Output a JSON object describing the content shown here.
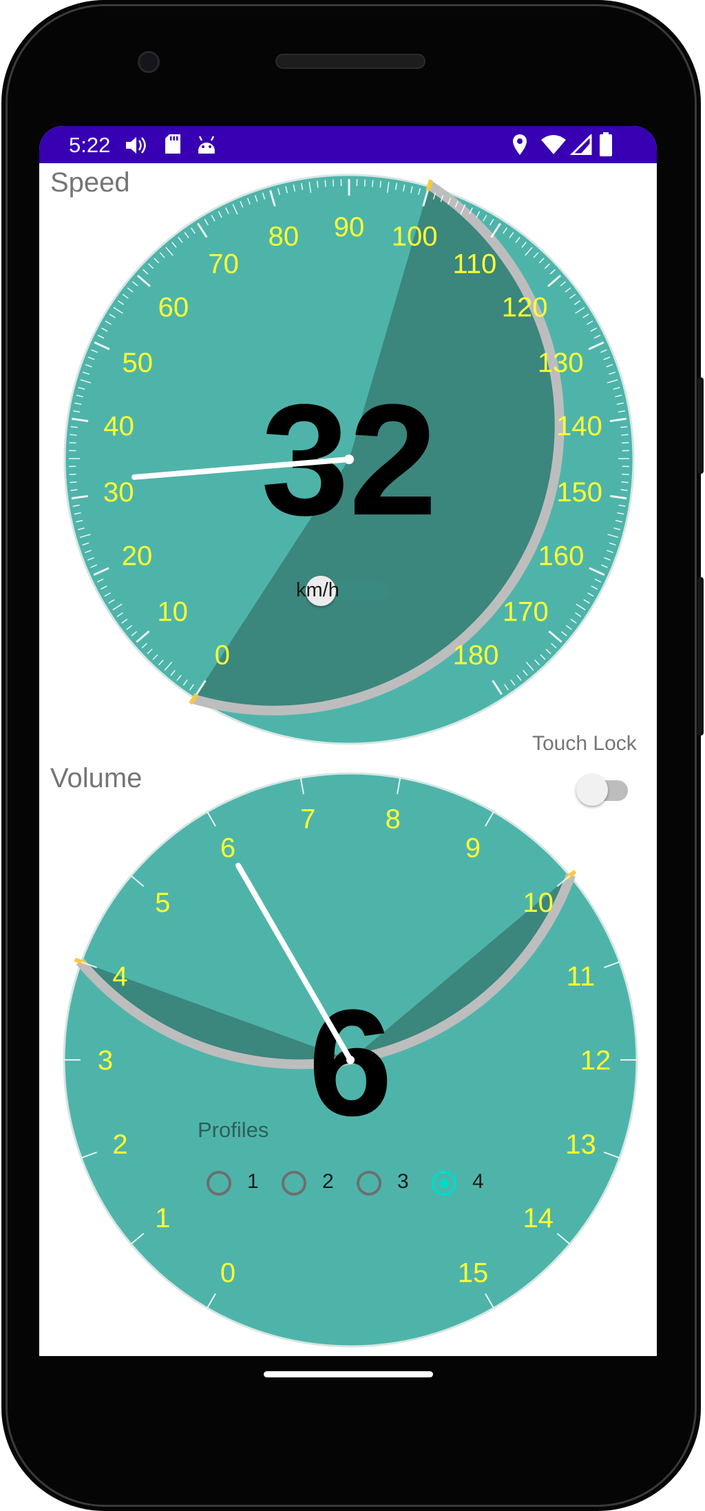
{
  "status_bar": {
    "time": "5:22",
    "left_icons": [
      "speaker-icon",
      "sd-card-icon",
      "android-debug-icon"
    ],
    "right_icons": [
      "location-icon",
      "wifi-icon",
      "cell-signal-icon",
      "battery-icon"
    ]
  },
  "speed": {
    "title": "Speed",
    "value": "32",
    "unit_label": "km/h",
    "unit_toggle_on": false,
    "needle_value": 32,
    "range": [
      0,
      180
    ],
    "highlight_value": 100,
    "ticks": [
      "0",
      "10",
      "20",
      "30",
      "40",
      "50",
      "60",
      "70",
      "80",
      "90",
      "100",
      "110",
      "120",
      "130",
      "140",
      "150",
      "160",
      "170",
      "180"
    ]
  },
  "volume": {
    "title": "Volume",
    "value": "6",
    "needle_value": 6,
    "range": [
      0,
      15
    ],
    "highlight_range": [
      4,
      10
    ],
    "ticks": [
      "0",
      "1",
      "2",
      "3",
      "4",
      "5",
      "6",
      "7",
      "8",
      "9",
      "10",
      "11",
      "12",
      "13",
      "14",
      "15"
    ]
  },
  "touch_lock": {
    "label": "Touch Lock",
    "enabled": false
  },
  "profiles": {
    "label": "Profiles",
    "options": [
      "1",
      "2",
      "3",
      "4"
    ],
    "selected": "4"
  },
  "colors": {
    "status_bar": "#3700b3",
    "gauge_face": "#4eb4aa",
    "gauge_highlight": "#3b867d",
    "tick_text": "#ffff33",
    "rim": "#bdbdbd",
    "marker": "#f7c842",
    "radio_checked": "#03dac5"
  }
}
